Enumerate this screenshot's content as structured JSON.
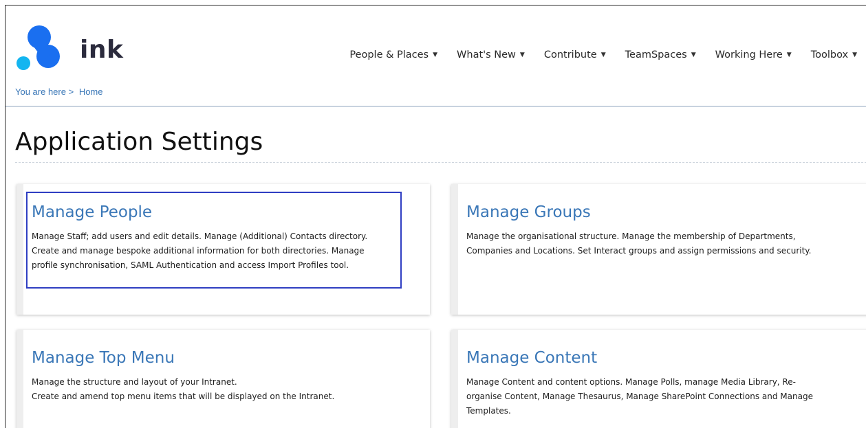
{
  "brand": {
    "name": "ink",
    "colors": {
      "primary_blue": "#1a6ff0",
      "light_blue": "#13b5f0",
      "text_dark": "#2b2b3d"
    }
  },
  "nav": [
    {
      "label": "People & Places",
      "icon": "caret-down-icon"
    },
    {
      "label": "What's New",
      "icon": "caret-down-icon"
    },
    {
      "label": "Contribute",
      "icon": "caret-down-icon"
    },
    {
      "label": "TeamSpaces",
      "icon": "caret-down-icon"
    },
    {
      "label": "Working Here",
      "icon": "caret-down-icon"
    },
    {
      "label": "Toolbox",
      "icon": "caret-down-icon"
    }
  ],
  "breadcrumb": {
    "prefix": "You are here >",
    "home": "Home"
  },
  "page": {
    "title": "Application Settings"
  },
  "cards": [
    {
      "title": "Manage People",
      "lines": [
        "Manage Staff; add users and edit details. Manage (Additional) Contacts directory.",
        "Create and manage bespoke additional information for both directories. Manage",
        "profile synchronisation, SAML Authentication and access Import Profiles tool."
      ],
      "highlighted": true,
      "highlight_color": "#2f3ec2"
    },
    {
      "title": "Manage Groups",
      "lines": [
        "Manage the organisational structure. Manage the membership of Departments,",
        "Companies and Locations. Set Interact groups and assign permissions and security."
      ]
    },
    {
      "title": "Manage Top Menu",
      "lines": [
        "Manage the structure and layout of your Intranet.",
        "Create and amend top menu items that will be displayed on the Intranet."
      ]
    },
    {
      "title": "Manage Content",
      "lines": [
        "Manage Content and content options. Manage Polls, manage Media Library, Re-",
        "organise Content, Manage Thesaurus, Manage SharePoint Connections and Manage",
        "Templates."
      ]
    }
  ]
}
